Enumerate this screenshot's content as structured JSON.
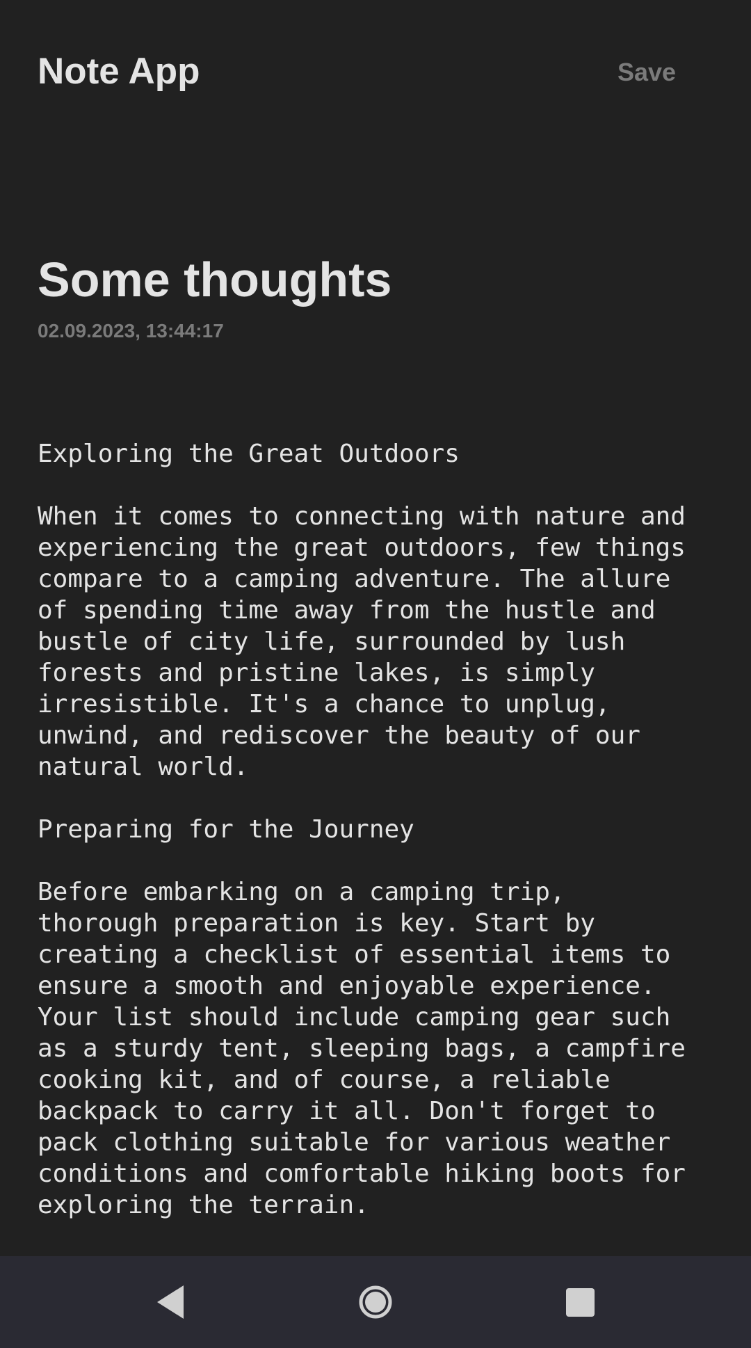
{
  "app_bar": {
    "title": "Note App",
    "save_label": "Save"
  },
  "note": {
    "title": "Some thoughts",
    "timestamp": "02.09.2023, 13:44:17",
    "body_lines": [
      "Exploring the Great Outdoors",
      "",
      "When it comes to connecting with nature and",
      "experiencing the great outdoors, few things",
      "compare to a camping adventure. The allure",
      "of spending time away from the hustle and",
      "bustle of city life, surrounded by lush",
      "forests and pristine lakes, is simply",
      "irresistible. It's a chance to unplug,",
      "unwind, and rediscover the beauty of our",
      "natural world.",
      "",
      "Preparing for the Journey",
      "",
      "Before embarking on a camping trip,",
      "thorough preparation is key. Start by",
      "creating a checklist of essential items to",
      "ensure a smooth and enjoyable experience.",
      "Your list should include camping gear such",
      "as a sturdy tent, sleeping bags, a campfire",
      "cooking kit, and of course, a reliable",
      "backpack to carry it all. Don't forget to",
      "pack clothing suitable for various weather",
      "conditions and comfortable hiking boots for",
      "exploring the terrain."
    ]
  },
  "nav_bar": {
    "icons": [
      "back-icon",
      "home-icon",
      "recents-icon"
    ]
  },
  "colors": {
    "background": "#212121",
    "primary_text": "#e4e4e4",
    "secondary_text": "#7b7b7b",
    "nav_bar": "#2a2a33",
    "nav_icon": "#d0d0d0"
  }
}
